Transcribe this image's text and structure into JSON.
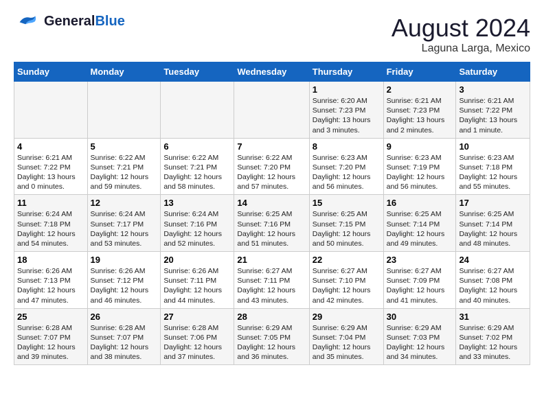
{
  "header": {
    "logo_general": "General",
    "logo_blue": "Blue",
    "month_year": "August 2024",
    "location": "Laguna Larga, Mexico"
  },
  "columns": [
    "Sunday",
    "Monday",
    "Tuesday",
    "Wednesday",
    "Thursday",
    "Friday",
    "Saturday"
  ],
  "weeks": [
    [
      {
        "day": "",
        "sunrise": "",
        "sunset": "",
        "daylight": ""
      },
      {
        "day": "",
        "sunrise": "",
        "sunset": "",
        "daylight": ""
      },
      {
        "day": "",
        "sunrise": "",
        "sunset": "",
        "daylight": ""
      },
      {
        "day": "",
        "sunrise": "",
        "sunset": "",
        "daylight": ""
      },
      {
        "day": "1",
        "sunrise": "Sunrise: 6:20 AM",
        "sunset": "Sunset: 7:23 PM",
        "daylight": "Daylight: 13 hours and 3 minutes."
      },
      {
        "day": "2",
        "sunrise": "Sunrise: 6:21 AM",
        "sunset": "Sunset: 7:23 PM",
        "daylight": "Daylight: 13 hours and 2 minutes."
      },
      {
        "day": "3",
        "sunrise": "Sunrise: 6:21 AM",
        "sunset": "Sunset: 7:22 PM",
        "daylight": "Daylight: 13 hours and 1 minute."
      }
    ],
    [
      {
        "day": "4",
        "sunrise": "Sunrise: 6:21 AM",
        "sunset": "Sunset: 7:22 PM",
        "daylight": "Daylight: 13 hours and 0 minutes."
      },
      {
        "day": "5",
        "sunrise": "Sunrise: 6:22 AM",
        "sunset": "Sunset: 7:21 PM",
        "daylight": "Daylight: 12 hours and 59 minutes."
      },
      {
        "day": "6",
        "sunrise": "Sunrise: 6:22 AM",
        "sunset": "Sunset: 7:21 PM",
        "daylight": "Daylight: 12 hours and 58 minutes."
      },
      {
        "day": "7",
        "sunrise": "Sunrise: 6:22 AM",
        "sunset": "Sunset: 7:20 PM",
        "daylight": "Daylight: 12 hours and 57 minutes."
      },
      {
        "day": "8",
        "sunrise": "Sunrise: 6:23 AM",
        "sunset": "Sunset: 7:20 PM",
        "daylight": "Daylight: 12 hours and 56 minutes."
      },
      {
        "day": "9",
        "sunrise": "Sunrise: 6:23 AM",
        "sunset": "Sunset: 7:19 PM",
        "daylight": "Daylight: 12 hours and 56 minutes."
      },
      {
        "day": "10",
        "sunrise": "Sunrise: 6:23 AM",
        "sunset": "Sunset: 7:18 PM",
        "daylight": "Daylight: 12 hours and 55 minutes."
      }
    ],
    [
      {
        "day": "11",
        "sunrise": "Sunrise: 6:24 AM",
        "sunset": "Sunset: 7:18 PM",
        "daylight": "Daylight: 12 hours and 54 minutes."
      },
      {
        "day": "12",
        "sunrise": "Sunrise: 6:24 AM",
        "sunset": "Sunset: 7:17 PM",
        "daylight": "Daylight: 12 hours and 53 minutes."
      },
      {
        "day": "13",
        "sunrise": "Sunrise: 6:24 AM",
        "sunset": "Sunset: 7:16 PM",
        "daylight": "Daylight: 12 hours and 52 minutes."
      },
      {
        "day": "14",
        "sunrise": "Sunrise: 6:25 AM",
        "sunset": "Sunset: 7:16 PM",
        "daylight": "Daylight: 12 hours and 51 minutes."
      },
      {
        "day": "15",
        "sunrise": "Sunrise: 6:25 AM",
        "sunset": "Sunset: 7:15 PM",
        "daylight": "Daylight: 12 hours and 50 minutes."
      },
      {
        "day": "16",
        "sunrise": "Sunrise: 6:25 AM",
        "sunset": "Sunset: 7:14 PM",
        "daylight": "Daylight: 12 hours and 49 minutes."
      },
      {
        "day": "17",
        "sunrise": "Sunrise: 6:25 AM",
        "sunset": "Sunset: 7:14 PM",
        "daylight": "Daylight: 12 hours and 48 minutes."
      }
    ],
    [
      {
        "day": "18",
        "sunrise": "Sunrise: 6:26 AM",
        "sunset": "Sunset: 7:13 PM",
        "daylight": "Daylight: 12 hours and 47 minutes."
      },
      {
        "day": "19",
        "sunrise": "Sunrise: 6:26 AM",
        "sunset": "Sunset: 7:12 PM",
        "daylight": "Daylight: 12 hours and 46 minutes."
      },
      {
        "day": "20",
        "sunrise": "Sunrise: 6:26 AM",
        "sunset": "Sunset: 7:11 PM",
        "daylight": "Daylight: 12 hours and 44 minutes."
      },
      {
        "day": "21",
        "sunrise": "Sunrise: 6:27 AM",
        "sunset": "Sunset: 7:11 PM",
        "daylight": "Daylight: 12 hours and 43 minutes."
      },
      {
        "day": "22",
        "sunrise": "Sunrise: 6:27 AM",
        "sunset": "Sunset: 7:10 PM",
        "daylight": "Daylight: 12 hours and 42 minutes."
      },
      {
        "day": "23",
        "sunrise": "Sunrise: 6:27 AM",
        "sunset": "Sunset: 7:09 PM",
        "daylight": "Daylight: 12 hours and 41 minutes."
      },
      {
        "day": "24",
        "sunrise": "Sunrise: 6:27 AM",
        "sunset": "Sunset: 7:08 PM",
        "daylight": "Daylight: 12 hours and 40 minutes."
      }
    ],
    [
      {
        "day": "25",
        "sunrise": "Sunrise: 6:28 AM",
        "sunset": "Sunset: 7:07 PM",
        "daylight": "Daylight: 12 hours and 39 minutes."
      },
      {
        "day": "26",
        "sunrise": "Sunrise: 6:28 AM",
        "sunset": "Sunset: 7:07 PM",
        "daylight": "Daylight: 12 hours and 38 minutes."
      },
      {
        "day": "27",
        "sunrise": "Sunrise: 6:28 AM",
        "sunset": "Sunset: 7:06 PM",
        "daylight": "Daylight: 12 hours and 37 minutes."
      },
      {
        "day": "28",
        "sunrise": "Sunrise: 6:29 AM",
        "sunset": "Sunset: 7:05 PM",
        "daylight": "Daylight: 12 hours and 36 minutes."
      },
      {
        "day": "29",
        "sunrise": "Sunrise: 6:29 AM",
        "sunset": "Sunset: 7:04 PM",
        "daylight": "Daylight: 12 hours and 35 minutes."
      },
      {
        "day": "30",
        "sunrise": "Sunrise: 6:29 AM",
        "sunset": "Sunset: 7:03 PM",
        "daylight": "Daylight: 12 hours and 34 minutes."
      },
      {
        "day": "31",
        "sunrise": "Sunrise: 6:29 AM",
        "sunset": "Sunset: 7:02 PM",
        "daylight": "Daylight: 12 hours and 33 minutes."
      }
    ]
  ]
}
